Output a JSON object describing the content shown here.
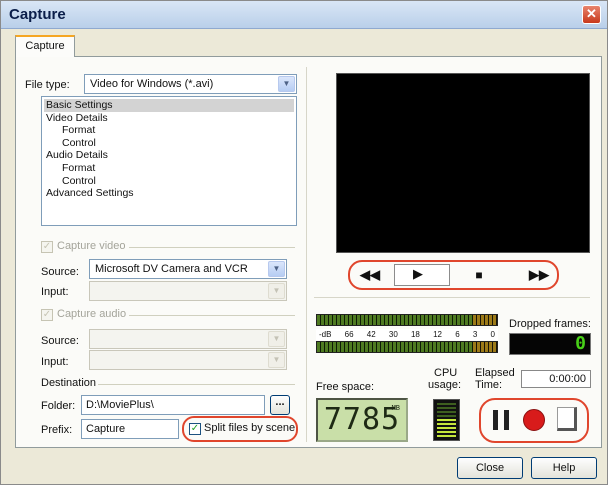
{
  "window": {
    "title": "Capture",
    "close_glyph": "✕"
  },
  "tabs": [
    {
      "label": "Capture"
    }
  ],
  "file_type": {
    "label": "File type:",
    "value": "Video for Windows (*.avi)"
  },
  "settings_tree": [
    {
      "label": "Basic Settings",
      "level": 0,
      "selected": true
    },
    {
      "label": "Video Details",
      "level": 0
    },
    {
      "label": "Format",
      "level": 1
    },
    {
      "label": "Control",
      "level": 1
    },
    {
      "label": "Audio Details",
      "level": 0
    },
    {
      "label": "Format",
      "level": 1
    },
    {
      "label": "Control",
      "level": 1
    },
    {
      "label": "Advanced Settings",
      "level": 0
    }
  ],
  "video": {
    "capture_label": "Capture video",
    "source_label": "Source:",
    "source_value": "Microsoft DV Camera and VCR",
    "input_label": "Input:",
    "input_value": ""
  },
  "audio": {
    "capture_label": "Capture audio",
    "source_label": "Source:",
    "source_value": "",
    "input_label": "Input:",
    "input_value": ""
  },
  "destination": {
    "group_label": "Destination",
    "folder_label": "Folder:",
    "folder_value": "D:\\MoviePlus\\",
    "browse_label": "...",
    "prefix_label": "Prefix:",
    "prefix_value": "Capture",
    "split_label": "Split files by scene",
    "split_checked": true
  },
  "transport": {
    "rewind": "◀◀",
    "play": "▶",
    "stop": "■",
    "forward": "▶▶"
  },
  "audio_meter": {
    "scale": [
      "-dB",
      "66",
      "42",
      "30",
      "18",
      "12",
      "6",
      "3",
      "0"
    ]
  },
  "dropped_frames": {
    "label": "Dropped frames:",
    "value": "0"
  },
  "free_space": {
    "label": "Free space:",
    "value": "7785",
    "unit": "MB"
  },
  "cpu_usage": {
    "label_line1": "CPU",
    "label_line2": "usage:",
    "level": 0.5
  },
  "elapsed": {
    "label_line1": "Elapsed",
    "label_line2": "Time:",
    "value": "0:00:00"
  },
  "buttons": {
    "close": "Close",
    "help": "Help"
  },
  "colors": {
    "highlight_ring": "#e0462d",
    "record": "#d81b1b",
    "lcd_text": "#48d018"
  }
}
